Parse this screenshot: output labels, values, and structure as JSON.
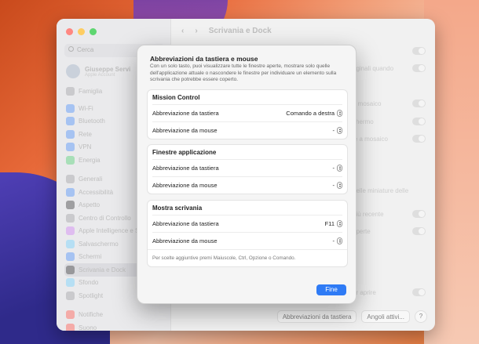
{
  "window": {
    "title": "Scrivania e Dock",
    "traffic_colors": [
      "#ff5f57",
      "#febc2e",
      "#28c840"
    ],
    "search_placeholder": "Cerca",
    "user": {
      "name": "Giuseppe Servi",
      "subtitle": "Apple Account"
    },
    "family": "Famiglia",
    "sidebar_items": [
      {
        "label": "Wi-Fi",
        "color": "#2f7bf5"
      },
      {
        "label": "Bluetooth",
        "color": "#2f7bf5"
      },
      {
        "label": "Rete",
        "color": "#2f7bf5"
      },
      {
        "label": "VPN",
        "color": "#2f7bf5"
      },
      {
        "label": "Energia",
        "color": "#34c759"
      },
      {
        "label": "Generali",
        "color": "#8e8e93"
      },
      {
        "label": "Accessibilità",
        "color": "#2f7bf5"
      },
      {
        "label": "Aspetto",
        "color": "#1c1c1e"
      },
      {
        "label": "Centro di Controllo",
        "color": "#8e8e93"
      },
      {
        "label": "Apple Intelligence e Siri",
        "color": "#c86bf0"
      },
      {
        "label": "Salvaschermo",
        "color": "#5ac8fa"
      },
      {
        "label": "Schermi",
        "color": "#2f7bf5"
      },
      {
        "label": "Scrivania e Dock",
        "color": "#1c1c1e"
      },
      {
        "label": "Sfondo",
        "color": "#5ac8fa"
      },
      {
        "label": "Spotlight",
        "color": "#8e8e93"
      },
      {
        "label": "Notifiche",
        "color": "#ff3b30"
      },
      {
        "label": "Suono",
        "color": "#ff3b30"
      }
    ],
    "bg_rows": [
      {
        "label": "",
        "right": ""
      },
      {
        "label": "riginali quando",
        "right": ""
      },
      {
        "label": "a mosaico",
        "right": ""
      },
      {
        "label": "chermo",
        "right": ""
      },
      {
        "label": "le a mosaico",
        "right": ""
      },
      {
        "label": "delle miniature delle",
        "right": ""
      },
      {
        "label": "più recente",
        "right": ""
      },
      {
        "label": "aperte",
        "right": ""
      },
      {
        "label": "er aprire",
        "right": ""
      }
    ],
    "bottom_buttons": {
      "shortcuts": "Abbreviazioni da tastiera",
      "hot_corners": "Angoli attivi...",
      "help": "?"
    }
  },
  "sheet": {
    "title": "Abbreviazioni da tastiera e mouse",
    "description": "Con un solo tasto, puoi visualizzare tutte le finestre aperte, mostrare solo quelle dell'applicazione attuale o nascondere le finestre per individuare un elemento sulla scrivania che potrebbe essere coperto.",
    "groups": [
      {
        "title": "Mission Control",
        "rows": [
          {
            "label": "Abbreviazione da tastiera",
            "value": "Comando a destra"
          },
          {
            "label": "Abbreviazione da mouse",
            "value": "-"
          }
        ]
      },
      {
        "title": "Finestre applicazione",
        "rows": [
          {
            "label": "Abbreviazione da tastiera",
            "value": "-"
          },
          {
            "label": "Abbreviazione da mouse",
            "value": "-"
          }
        ]
      },
      {
        "title": "Mostra scrivania",
        "rows": [
          {
            "label": "Abbreviazione da tastiera",
            "value": "F11"
          },
          {
            "label": "Abbreviazione da mouse",
            "value": "-"
          }
        ],
        "note": "Per scelte aggiuntive premi Maiuscole, Ctrl, Opzione o Comando."
      }
    ],
    "done_label": "Fine"
  }
}
